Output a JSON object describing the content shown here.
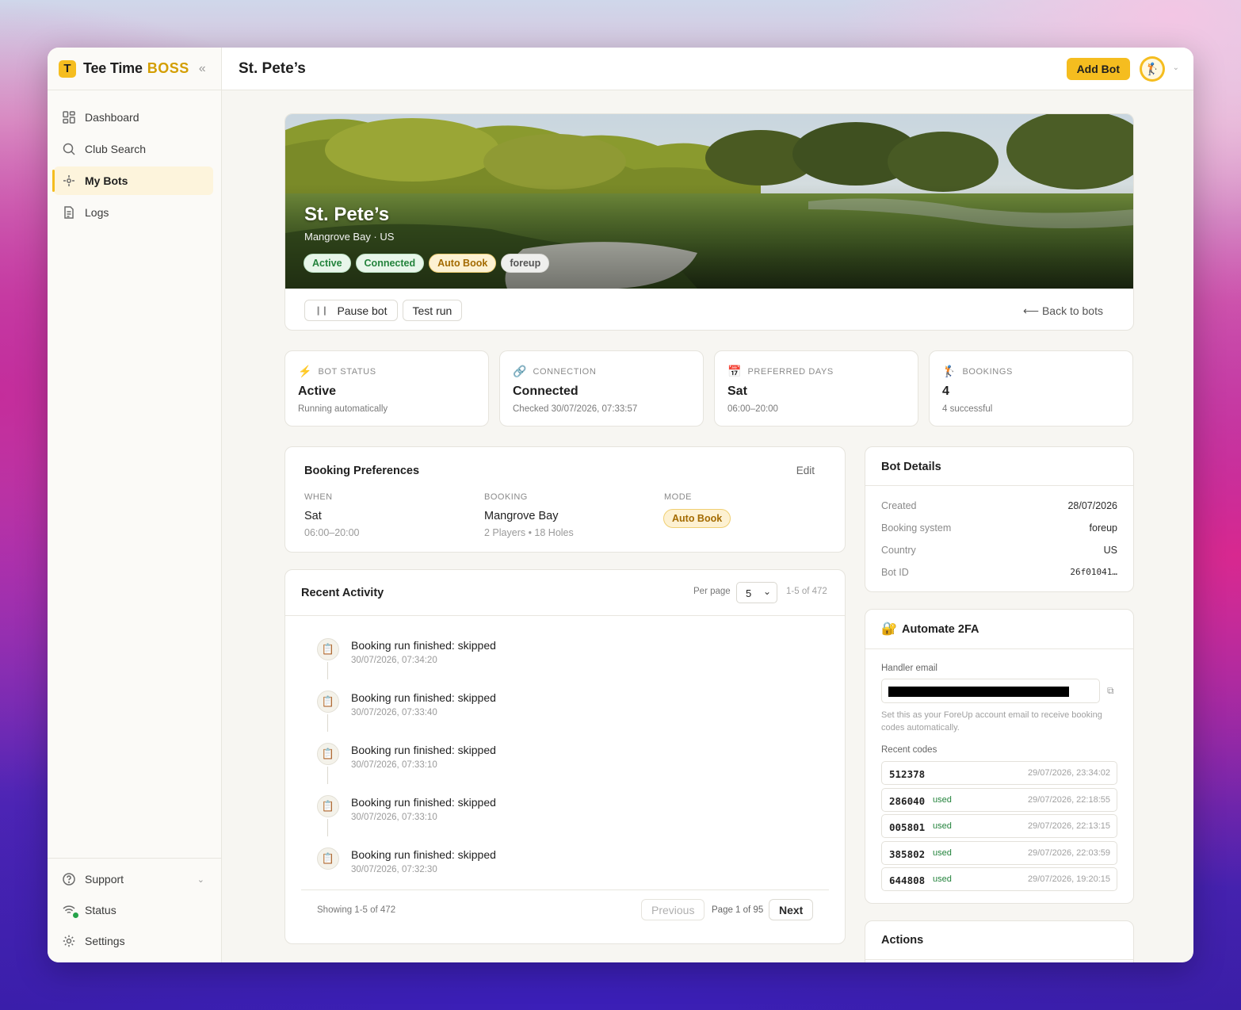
{
  "brand": {
    "logo_letter": "T",
    "name": "Tee Time",
    "suffix": "BOSS",
    "collapse_icon": "«"
  },
  "nav": {
    "items": [
      {
        "label": "Dashboard",
        "icon": "dashboard-icon"
      },
      {
        "label": "Club Search",
        "icon": "search-icon"
      },
      {
        "label": "My Bots",
        "icon": "bot-icon",
        "active": true
      },
      {
        "label": "Logs",
        "icon": "document-icon"
      }
    ],
    "bottom": [
      {
        "label": "Support",
        "icon": "help-icon"
      },
      {
        "label": "Status",
        "icon": "wifi-icon"
      },
      {
        "label": "Settings",
        "icon": "gear-icon"
      }
    ]
  },
  "header": {
    "title": "St. Pete’s",
    "add_bot": "Add Bot"
  },
  "hero": {
    "title": "St. Pete’s",
    "subtitle": "Mangrove Bay · US",
    "chips": [
      "Active",
      "Connected",
      "Auto Book",
      "foreup"
    ],
    "pause": "Pause bot",
    "test_run": "Test run",
    "back": "⟵ Back to bots"
  },
  "stats": [
    {
      "label": "BOT STATUS",
      "icon": "⚡",
      "value": "Active",
      "sub": "Running automatically"
    },
    {
      "label": "CONNECTION",
      "icon": "🔗",
      "value": "Connected",
      "sub": "Checked 30/07/2026, 07:33:57"
    },
    {
      "label": "PREFERRED DAYS",
      "icon": "📅",
      "value": "Sat",
      "sub": "06:00–20:00"
    },
    {
      "label": "BOOKINGS",
      "icon": "🏌",
      "value": "4",
      "sub": "4 successful"
    }
  ],
  "prefs": {
    "title": "Booking Preferences",
    "edit": "Edit",
    "when_label": "WHEN",
    "when_value": "Sat",
    "when_sub": "06:00–20:00",
    "booking_label": "BOOKING",
    "booking_value": "Mangrove Bay",
    "booking_sub": "2 Players • 18 Holes",
    "mode_label": "MODE",
    "mode_value": "Auto Book"
  },
  "activity": {
    "title": "Recent Activity",
    "per_page_label": "Per page",
    "per_page": "5",
    "range": "1-5 of 472",
    "items": [
      {
        "title": "Booking run finished: skipped",
        "time": "30/07/2026, 07:34:20"
      },
      {
        "title": "Booking run finished: skipped",
        "time": "30/07/2026, 07:33:40"
      },
      {
        "title": "Booking run finished: skipped",
        "time": "30/07/2026, 07:33:10"
      },
      {
        "title": "Booking run finished: skipped",
        "time": "30/07/2026, 07:33:10"
      },
      {
        "title": "Booking run finished: skipped",
        "time": "30/07/2026, 07:32:30"
      }
    ],
    "showing": "Showing 1-5 of 472",
    "previous": "Previous",
    "page": "Page 1 of 95",
    "next": "Next"
  },
  "details": {
    "title": "Bot Details",
    "rows": [
      {
        "k": "Created",
        "v": "28/07/2026"
      },
      {
        "k": "Booking system",
        "v": "foreup"
      },
      {
        "k": "Country",
        "v": "US"
      },
      {
        "k": "Bot ID",
        "v": "26f01041…"
      }
    ]
  },
  "twofa": {
    "title": "Automate 2FA",
    "icon": "🔐",
    "handler_label": "Handler email",
    "help": "Set this as your ForeUp account email to receive booking codes automatically.",
    "recent_label": "Recent codes",
    "codes": [
      {
        "code": "512378",
        "used": "",
        "ts": "29/07/2026, 23:34:02"
      },
      {
        "code": "286040",
        "used": "used",
        "ts": "29/07/2026, 22:18:55"
      },
      {
        "code": "005801",
        "used": "used",
        "ts": "29/07/2026, 22:13:15"
      },
      {
        "code": "385802",
        "used": "used",
        "ts": "29/07/2026, 22:03:59"
      },
      {
        "code": "644808",
        "used": "used",
        "ts": "29/07/2026, 19:20:15"
      }
    ]
  },
  "actions": {
    "title": "Actions"
  },
  "colors": {
    "accent": "#f5bd1f",
    "success": "#23833c",
    "amber_text": "#a36a00"
  }
}
